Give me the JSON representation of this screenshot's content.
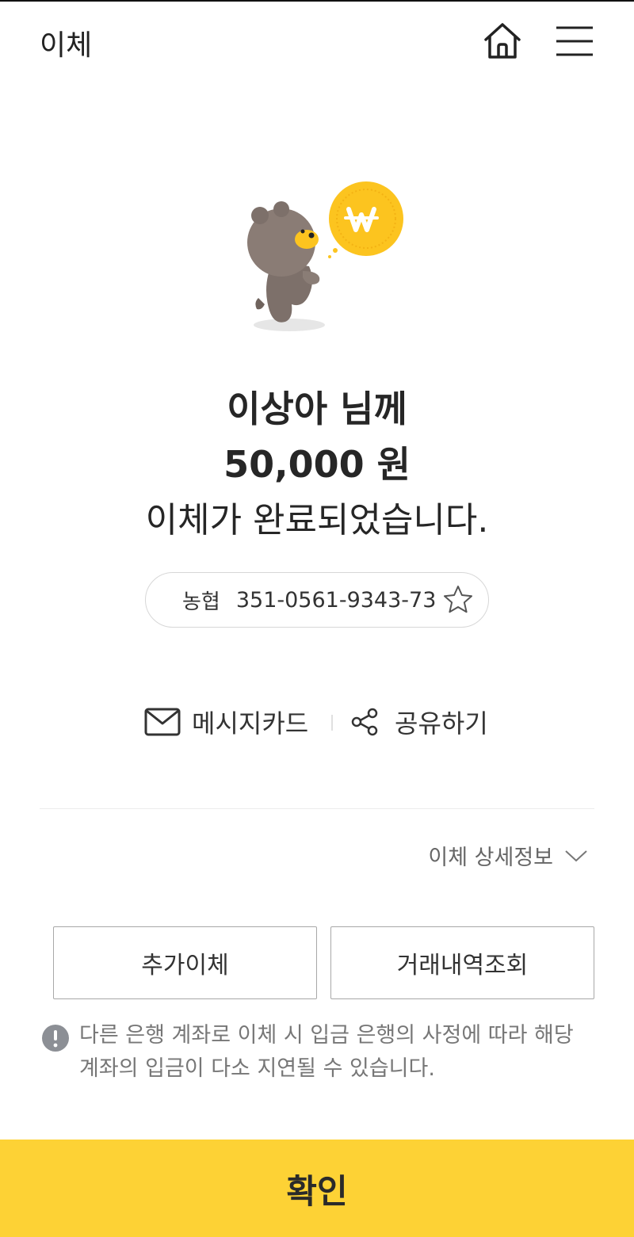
{
  "header": {
    "title": "이체",
    "home_icon": "home-icon",
    "menu_icon": "hamburger-menu-icon"
  },
  "result": {
    "recipient": "이상아 님께",
    "amount": "50,000 원",
    "message": "이체가 완료되었습니다."
  },
  "account": {
    "bank": "농협",
    "number": "351-0561-9343-73",
    "favorite_icon": "star-outline-icon"
  },
  "actions": {
    "message_card_label": "메시지카드",
    "share_label": "공유하기"
  },
  "details": {
    "label": "이체 상세정보"
  },
  "buttons": {
    "add_transfer": "추가이체",
    "history": "거래내역조회"
  },
  "notice": {
    "text": "다른 은행 계좌로 이체 시 입금 은행의 사정에 따라 해당 계좌의 입금이 다소 지연될 수 있습니다."
  },
  "confirm": {
    "label": "확인"
  },
  "colors": {
    "accent": "#fdd235",
    "mascot_body": "#7d706a",
    "coin": "#fcc41f"
  }
}
